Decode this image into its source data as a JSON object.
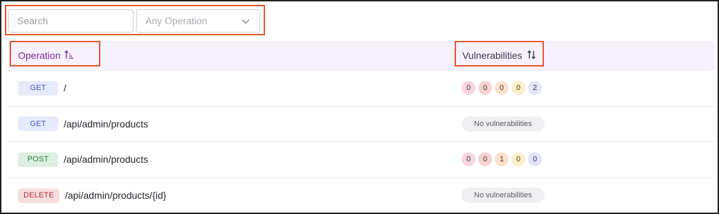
{
  "search": {
    "placeholder": "Search"
  },
  "filter": {
    "placeholder": "Any Operation"
  },
  "table": {
    "columns": {
      "operation": "Operation",
      "vulnerabilities": "Vulnerabilities"
    },
    "rows": [
      {
        "method": "GET",
        "path": "/",
        "counts": [
          "0",
          "0",
          "0",
          "0",
          "2"
        ]
      },
      {
        "method": "GET",
        "path": "/api/admin/products",
        "empty": "No vulnerabilities"
      },
      {
        "method": "POST",
        "path": "/api/admin/products",
        "counts": [
          "0",
          "0",
          "1",
          "0",
          "0"
        ]
      },
      {
        "method": "DELETE",
        "path": "/api/admin/products/{id}",
        "empty": "No vulnerabilities"
      }
    ]
  },
  "colors": {
    "get_bg": "#e6eafb",
    "get_fg": "#4257c4",
    "post_bg": "#dcefe0",
    "post_fg": "#2f7a44",
    "delete_bg": "#f7dede",
    "delete_fg": "#b2333a",
    "sev1": "#f6d4e2",
    "sev2": "#f6d3d3",
    "sev3": "#fbe0cc",
    "sev4": "#fdefc8",
    "sev5": "#e1e6fb",
    "annotation": "#e4572e"
  }
}
